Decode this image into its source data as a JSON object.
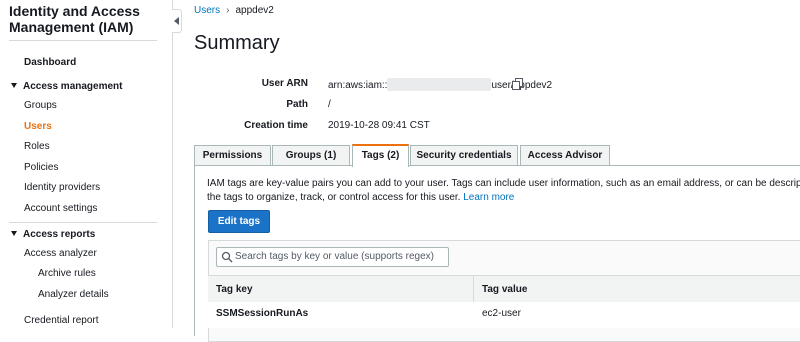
{
  "sidebar": {
    "title": "Identity and Access Management (IAM)",
    "dashboard": "Dashboard",
    "access_management": "Access management",
    "items": [
      "Groups",
      "Users",
      "Roles",
      "Policies",
      "Identity providers",
      "Account settings"
    ],
    "access_reports": "Access reports",
    "access_analyzer": "Access analyzer",
    "sub_items": [
      "Archive rules",
      "Analyzer details"
    ],
    "credential_report": "Credential report"
  },
  "breadcrumb": {
    "parent": "Users",
    "separator": "›",
    "current": "appdev2"
  },
  "summary": {
    "title": "Summary",
    "user_arn_label": "User ARN",
    "user_arn_prefix": "arn:aws:iam::",
    "user_arn_suffix": "user/appdev2",
    "path_label": "Path",
    "path_value": "/",
    "creation_time_label": "Creation time",
    "creation_time_value": "2019-10-28 09:41 CST"
  },
  "tabs": [
    "Permissions",
    "Groups (1)",
    "Tags (2)",
    "Security credentials",
    "Access Advisor"
  ],
  "active_tab": "Tags (2)",
  "tags_panel": {
    "description_line1": "IAM tags are key-value pairs you can add to your user. Tags can include user information, such as an email address, or can be descriptive, suc",
    "description_line2": "the tags to organize, track, or control access for this user.",
    "learn_more": "Learn more",
    "edit_button": "Edit tags",
    "search_placeholder": "Search tags by key or value (supports regex)",
    "columns": [
      "Tag key",
      "Tag value"
    ],
    "rows": [
      {
        "key": "SSMSessionRunAs",
        "value": "ec2-user"
      }
    ]
  },
  "colors": {
    "accent": "#ec7211",
    "link": "#0073bb",
    "primary_button": "#1a73c7"
  }
}
